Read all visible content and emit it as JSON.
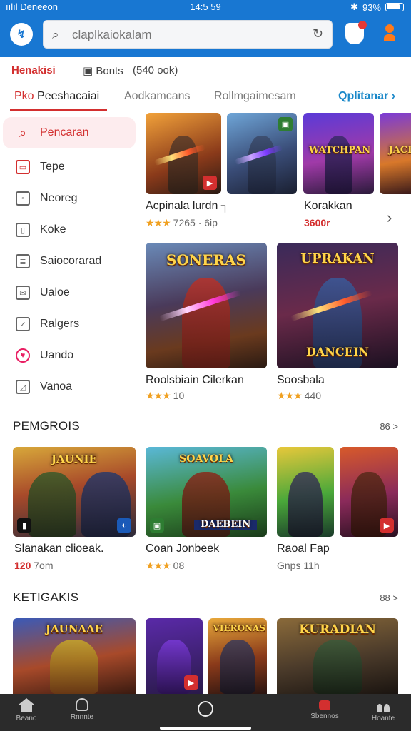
{
  "status_bar": {
    "left": "ıılıl Deneeon",
    "time": "14:5 59",
    "battery": "93%"
  },
  "header": {
    "logo": "↯",
    "search_placeholder": "claplkaiokalam"
  },
  "subheader": {
    "brand": "Henakisi",
    "meta1": "Bonts",
    "meta2": "(540 ook)"
  },
  "tabs": [
    {
      "label_a": "Pko",
      "label_b": "Peeshacaiai"
    },
    {
      "label": "Aodkamcans"
    },
    {
      "label": "Rollmgaimesam"
    },
    {
      "label": "Qplitanar"
    }
  ],
  "sidebar": {
    "items": [
      {
        "label": "Pencaran",
        "icon": "search-icon"
      },
      {
        "label": "Tepe",
        "icon": "tv-icon"
      },
      {
        "label": "Neoreg",
        "icon": "chat-icon"
      },
      {
        "label": "Koke",
        "icon": "book-icon"
      },
      {
        "label": "Saiocorarad",
        "icon": "clipboard-icon"
      },
      {
        "label": "Ualoe",
        "icon": "mail-icon"
      },
      {
        "label": "Ralgers",
        "icon": "checklist-icon"
      },
      {
        "label": "Uando",
        "icon": "heart-icon"
      },
      {
        "label": "Vanoa",
        "icon": "note-icon"
      }
    ]
  },
  "featured": {
    "cards": [
      {
        "title": "Acpinala lurdn ┐",
        "stars": "★★★",
        "meta": "7265 · 6ip"
      },
      {
        "title": "Korakkan",
        "price": "3600r"
      }
    ],
    "banners": [
      "WATCHPAN",
      "JACI"
    ],
    "large": [
      {
        "title": "Roolsbiain Cilerkan",
        "stars": "★★★",
        "meta": "10",
        "banner": "SONERAS"
      },
      {
        "title": "Soosbala",
        "stars": "★★★",
        "meta": "440",
        "banner": "UPRAKAN",
        "banner2": "DANCEIN"
      }
    ]
  },
  "section1": {
    "title": "PEMGROIS",
    "more": "86 >",
    "cards": [
      {
        "title": "Slanakan clioeak.",
        "price": "120",
        "meta": "7om",
        "banner": "JAUNIE"
      },
      {
        "title": "Coan Jonbeek",
        "stars": "★★★",
        "meta": "08",
        "banner": "SOAVOLA",
        "banner2": "DAEBEIN"
      },
      {
        "title": "Raoal Fap",
        "meta": "Gnps 11h"
      }
    ]
  },
  "section2": {
    "title": "KETIGAKIS",
    "more": "88 >",
    "banners": [
      "JAUNAAE",
      "VIERONAS",
      "KURADIAN"
    ]
  },
  "bottom_nav": [
    {
      "label": "Beano",
      "icon": "home-icon"
    },
    {
      "label": "Rnnnte",
      "icon": "bag-icon"
    },
    {
      "label": "",
      "icon": "home-circle-icon"
    },
    {
      "label": "Sbennos",
      "icon": "chat-badge-icon"
    },
    {
      "label": "Hoante",
      "icon": "people-icon"
    }
  ],
  "colors": {
    "header": "#1877d2",
    "accent": "#d32f2f",
    "link": "#1a88c9"
  }
}
